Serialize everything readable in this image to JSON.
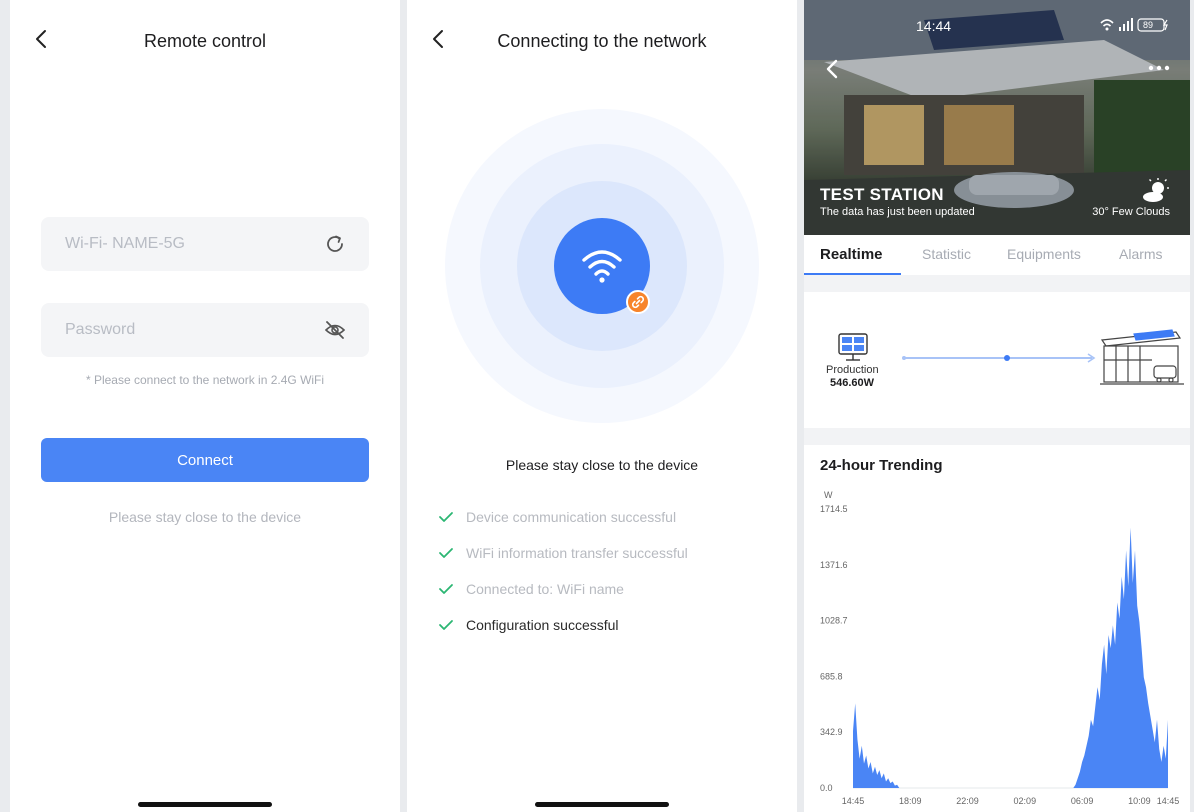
{
  "screen1": {
    "title": "Remote control",
    "wifi_placeholder": "Wi-Fi- NAME-5G",
    "password_placeholder": "Password",
    "hint": "* Please connect to the network in 2.4G WiFi",
    "connect_label": "Connect",
    "footer_note": "Please stay close to the device"
  },
  "screen2": {
    "title": "Connecting to the network",
    "stay_close": "Please stay close to the device",
    "steps": [
      {
        "label": "Device communication successful",
        "done": false
      },
      {
        "label": "WiFi information transfer successful",
        "done": false
      },
      {
        "label": "Connected to: WiFi name",
        "done": false
      },
      {
        "label": "Configuration successful",
        "done": true
      }
    ]
  },
  "screen3": {
    "status_time": "14:44",
    "battery": "89",
    "station_name": "TEST STATION",
    "updated_text": "The data has just been updated",
    "weather": "30° Few Clouds",
    "tabs": [
      "Realtime",
      "Statistic",
      "Equipments",
      "Alarms"
    ],
    "active_tab": "Realtime",
    "production_label": "Production",
    "production_value": "546.60W",
    "trend_title": "24-hour Trending",
    "colors": {
      "accent": "#3d7bf5",
      "chart_fill": "#4a85f5",
      "success": "#2bb673"
    }
  },
  "chart_data": {
    "type": "area",
    "title": "24-hour Trending",
    "ylabel": "W",
    "ylim": [
      0,
      1714.5
    ],
    "yticks": [
      "1714.5",
      "1371.6",
      "1028.7",
      "685.8",
      "342.9",
      "0.0"
    ],
    "xticks": [
      "14:45",
      "18:09",
      "22:09",
      "02:09",
      "06:09",
      "10:09",
      "14:45"
    ],
    "series": [
      {
        "values": [
          [
            0,
            350
          ],
          [
            1,
            520
          ],
          [
            2,
            300
          ],
          [
            3,
            180
          ],
          [
            4,
            260
          ],
          [
            5,
            150
          ],
          [
            6,
            200
          ],
          [
            7,
            120
          ],
          [
            8,
            160
          ],
          [
            9,
            90
          ],
          [
            10,
            130
          ],
          [
            11,
            80
          ],
          [
            12,
            110
          ],
          [
            13,
            60
          ],
          [
            14,
            90
          ],
          [
            15,
            40
          ],
          [
            16,
            60
          ],
          [
            17,
            30
          ],
          [
            18,
            40
          ],
          [
            19,
            15
          ],
          [
            20,
            20
          ],
          [
            21,
            0
          ],
          [
            100,
            0
          ],
          [
            101,
            20
          ],
          [
            102,
            60
          ],
          [
            103,
            100
          ],
          [
            104,
            160
          ],
          [
            105,
            200
          ],
          [
            106,
            260
          ],
          [
            107,
            320
          ],
          [
            108,
            420
          ],
          [
            109,
            380
          ],
          [
            110,
            500
          ],
          [
            111,
            620
          ],
          [
            112,
            540
          ],
          [
            113,
            760
          ],
          [
            114,
            880
          ],
          [
            115,
            700
          ],
          [
            116,
            940
          ],
          [
            117,
            860
          ],
          [
            118,
            1000
          ],
          [
            119,
            880
          ],
          [
            120,
            1140
          ],
          [
            121,
            1040
          ],
          [
            122,
            1300
          ],
          [
            123,
            1160
          ],
          [
            124,
            1460
          ],
          [
            125,
            1240
          ],
          [
            126,
            1600
          ],
          [
            127,
            1260
          ],
          [
            128,
            1460
          ],
          [
            129,
            1120
          ],
          [
            130,
            1020
          ],
          [
            131,
            860
          ],
          [
            132,
            680
          ],
          [
            133,
            620
          ],
          [
            134,
            520
          ],
          [
            135,
            440
          ],
          [
            136,
            360
          ],
          [
            137,
            280
          ],
          [
            138,
            420
          ],
          [
            139,
            240
          ],
          [
            140,
            160
          ],
          [
            141,
            260
          ],
          [
            142,
            180
          ],
          [
            143,
            420
          ]
        ]
      }
    ]
  }
}
